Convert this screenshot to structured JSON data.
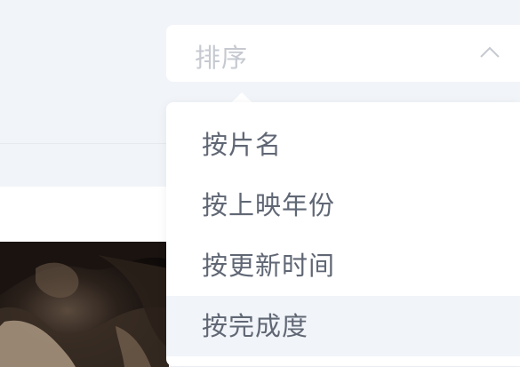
{
  "sort_select": {
    "placeholder": "排序",
    "expanded": true,
    "icon": "chevron-up-icon"
  },
  "sort_options": [
    {
      "label": "按片名"
    },
    {
      "label": "按上映年份"
    },
    {
      "label": "按更新时间"
    },
    {
      "label": "按完成度",
      "highlighted": true
    }
  ],
  "colors": {
    "page_background": "#f1f4f8",
    "panel_background": "#ffffff",
    "option_text": "#606774",
    "placeholder_text": "#c6c9d0",
    "hover_background": "#f1f4f8"
  }
}
